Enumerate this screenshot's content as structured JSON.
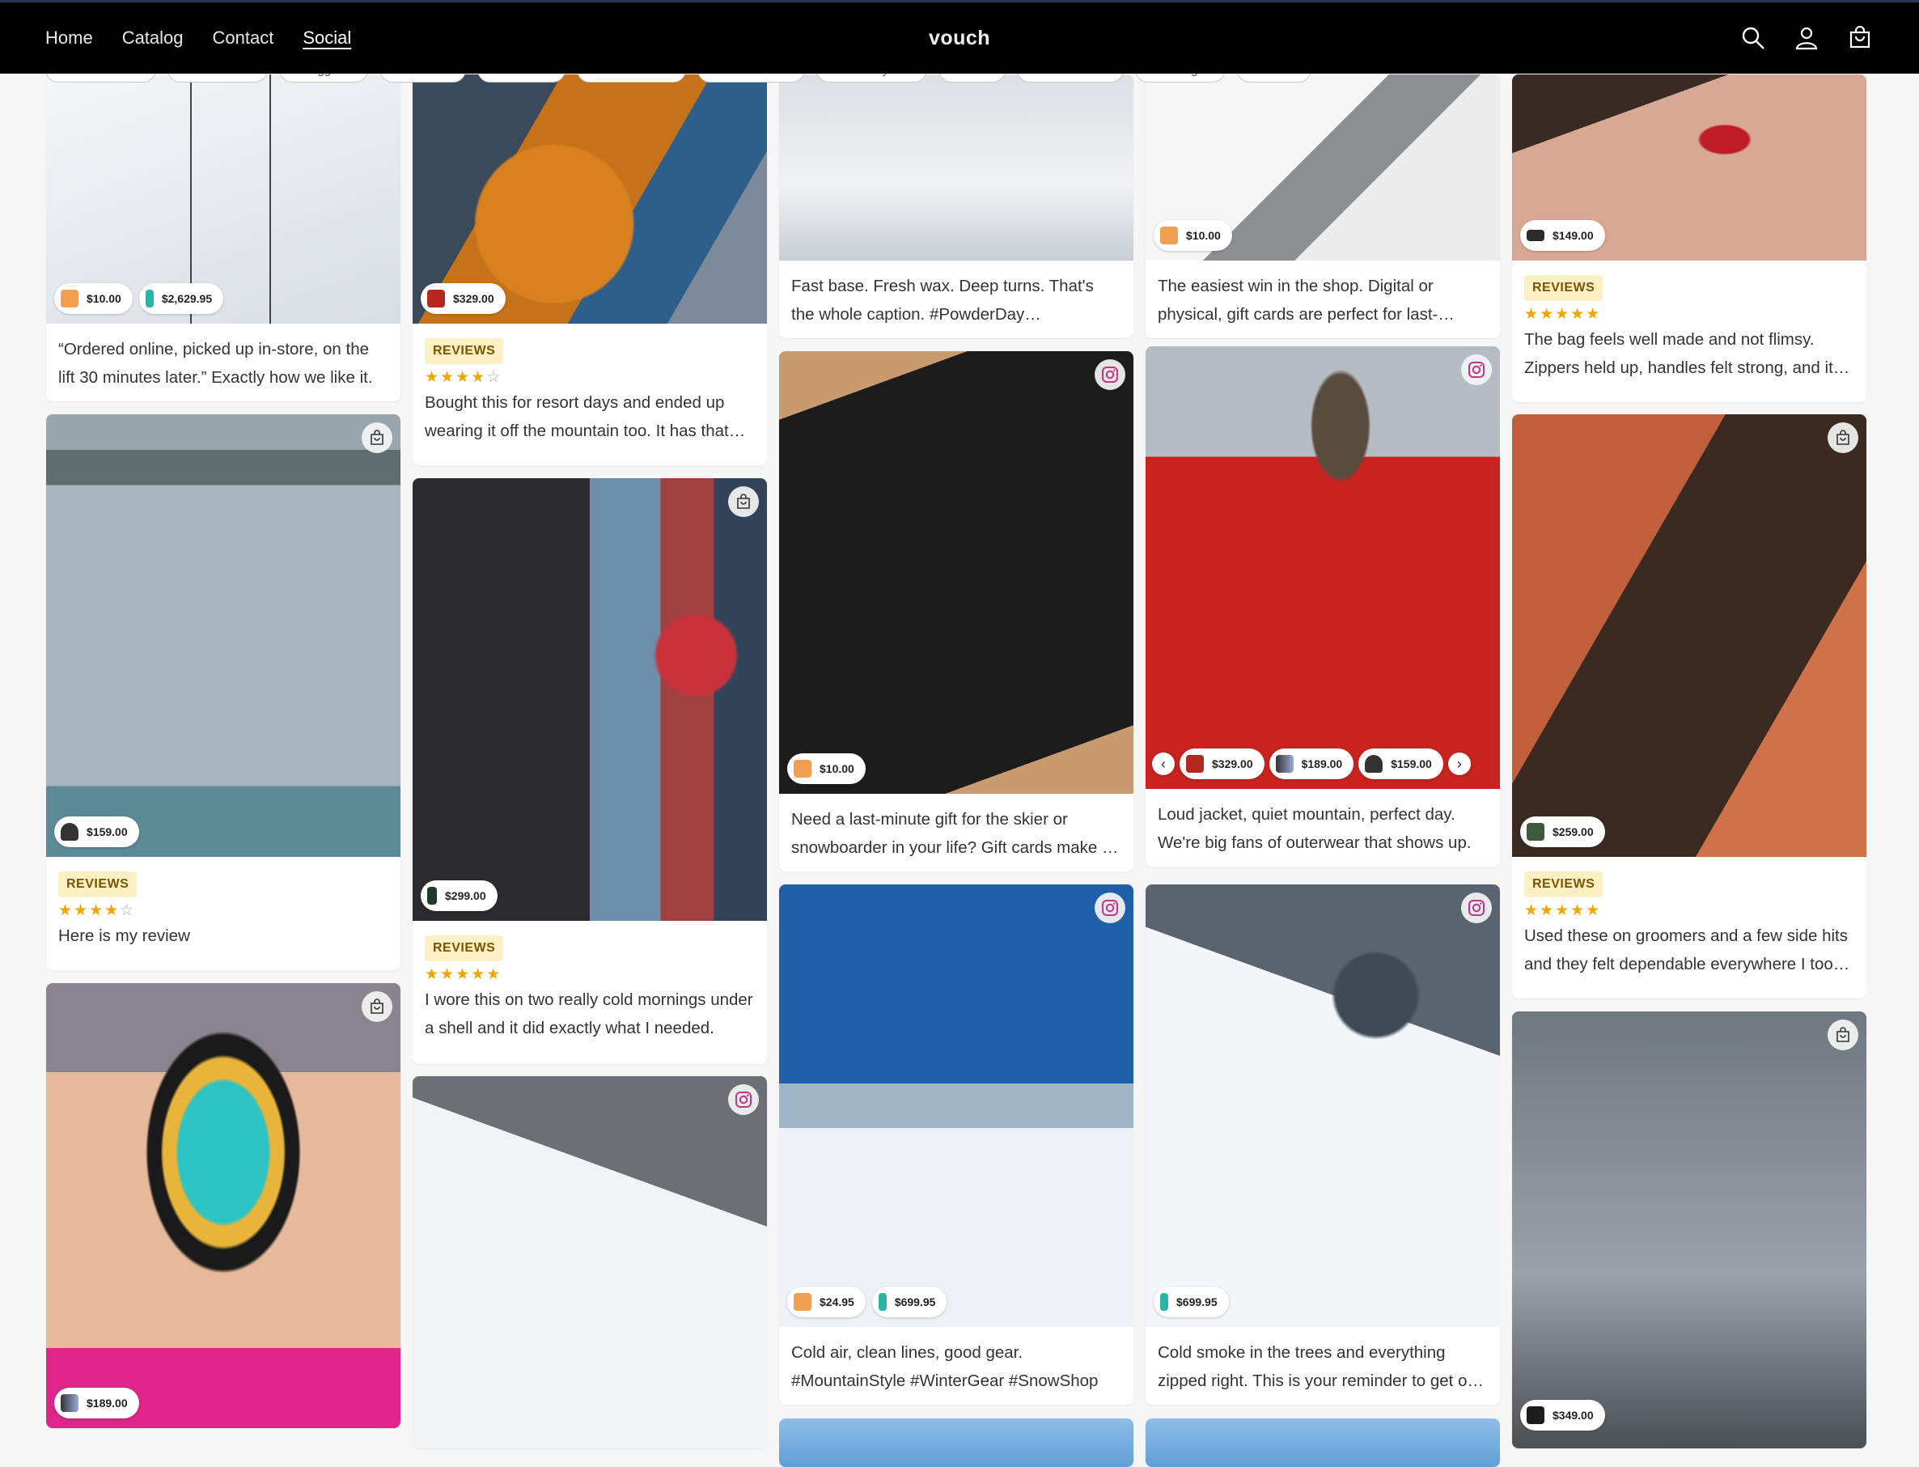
{
  "header": {
    "nav": [
      "Home",
      "Catalog",
      "Contact",
      "Social"
    ],
    "active_nav": "Social",
    "brand": "vouch",
    "icons": [
      "search-icon",
      "account-icon",
      "cart-icon"
    ]
  },
  "filter_chips": [
    "Snowboards",
    "Outerwear",
    "Goggles",
    "Giftcard",
    "Helmets",
    "Accessories",
    "accessories",
    "Base Layers",
    "Skis",
    "Travel Gear",
    "Bindings",
    "Boots"
  ],
  "colors": {
    "review_badge_bg": "#fdf0c4",
    "star": "#f0a500",
    "instagram": "#c13584"
  },
  "cards": [
    {
      "id": "c1",
      "type": "photo",
      "corner": "none",
      "products": [
        {
          "icon": "giftcard-thumb",
          "price": "$10.00"
        },
        {
          "icon": "snowboard-thumb",
          "price": "$2,629.95"
        }
      ],
      "caption": "“Ordered online, picked up in-store, on the lift 30 minutes later.” Exactly how we like it."
    },
    {
      "id": "c2",
      "type": "review",
      "corner": "shop-icon",
      "products": [
        {
          "icon": "helmet-thumb",
          "price": "$159.00"
        }
      ],
      "badge": "REVIEWS",
      "rating": 4,
      "text": "Here is my review"
    },
    {
      "id": "c3",
      "type": "photo",
      "corner": "shop-icon",
      "products": [
        {
          "icon": "goggles-thumb",
          "price": "$189.00"
        }
      ]
    },
    {
      "id": "c4",
      "type": "review",
      "corner": "none",
      "products": [
        {
          "icon": "jacket-thumb",
          "price": "$329.00"
        }
      ],
      "badge": "REVIEWS",
      "rating": 4,
      "text": "Bought this for resort days and ended up wearing it off the mountain too. It has that clean look."
    },
    {
      "id": "c5",
      "type": "review",
      "corner": "shop-icon",
      "products": [
        {
          "icon": "bottle-thumb",
          "price": "$299.00"
        }
      ],
      "badge": "REVIEWS",
      "rating": 5,
      "text": "I wore this on two really cold mornings under a shell and it did exactly what I needed."
    },
    {
      "id": "c6",
      "type": "photo",
      "corner": "instagram-icon",
      "products": []
    },
    {
      "id": "c7",
      "type": "photo",
      "corner": "none",
      "products": [],
      "caption": "Fast base. Fresh wax. Deep turns. That's the whole caption. #PowderDay #RideFastLiveSlow"
    },
    {
      "id": "c8",
      "type": "photo",
      "corner": "instagram-icon",
      "products": [
        {
          "icon": "giftcard-thumb",
          "price": "$10.00"
        }
      ],
      "caption": "Need a last-minute gift for the skier or snowboarder in your life? Gift cards make it easy."
    },
    {
      "id": "c9",
      "type": "photo",
      "corner": "instagram-icon",
      "products": [
        {
          "icon": "giftcard-thumb",
          "price": "$24.95"
        },
        {
          "icon": "snowboard-thumb",
          "price": "$699.95"
        }
      ],
      "caption": "Cold air, clean lines, good gear. #MountainStyle #WinterGear #SnowShop"
    },
    {
      "id": "c10",
      "type": "photo",
      "corner": "none",
      "products": [
        {
          "icon": "giftcard-thumb",
          "price": "$10.00"
        }
      ],
      "caption": "The easiest win in the shop. Digital or physical, gift cards are perfect for last-minute gifts."
    },
    {
      "id": "c11",
      "type": "photo",
      "corner": "instagram-icon",
      "products": [
        {
          "icon": "jacket-thumb",
          "price": "$329.00"
        },
        {
          "icon": "goggles-thumb",
          "price": "$189.00"
        },
        {
          "icon": "helmet-thumb",
          "price": "$159.00"
        }
      ],
      "caption": "Loud jacket, quiet mountain, perfect day. We're big fans of outerwear that shows up."
    },
    {
      "id": "c12",
      "type": "photo",
      "corner": "instagram-icon",
      "products": [
        {
          "icon": "snowboard-thumb",
          "price": "$699.95"
        }
      ],
      "caption": "Cold smoke in the trees and everything zipped right. This is your reminder to get out there."
    },
    {
      "id": "c13",
      "type": "review",
      "corner": "none",
      "products": [
        {
          "icon": "bag-thumb",
          "price": "$149.00"
        }
      ],
      "badge": "REVIEWS",
      "rating": 5,
      "text": "The bag feels well made and not flimsy. Zippers held up, handles felt strong, and it fit everything."
    },
    {
      "id": "c14",
      "type": "review",
      "corner": "shop-icon",
      "products": [
        {
          "icon": "binding-thumb",
          "price": "$259.00"
        }
      ],
      "badge": "REVIEWS",
      "rating": 5,
      "text": "Used these on groomers and a few side hits and they felt dependable everywhere I took them."
    },
    {
      "id": "c15",
      "type": "photo",
      "corner": "shop-icon",
      "products": [
        {
          "icon": "boots-thumb",
          "price": "$349.00"
        }
      ]
    }
  ]
}
